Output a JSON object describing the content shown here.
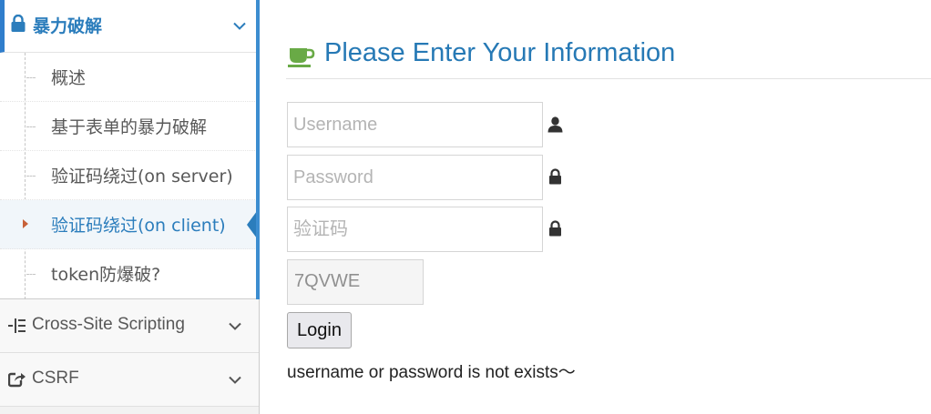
{
  "sidebar": {
    "section": {
      "label": "暴力破解",
      "icon": "lock-icon"
    },
    "items": [
      {
        "label": "概述"
      },
      {
        "label": "基于表单的暴力破解"
      },
      {
        "label": "验证码绕过(on server)"
      },
      {
        "label": "验证码绕过(on client)",
        "active": true
      },
      {
        "label": "token防爆破?"
      }
    ],
    "nav": [
      {
        "label": "Cross-Site Scripting",
        "icon": "list-indent-icon"
      },
      {
        "label": "CSRF",
        "icon": "share-icon"
      }
    ]
  },
  "header": {
    "title": "Please Enter Your Information",
    "icon": "coffee-cup-icon"
  },
  "form": {
    "username_placeholder": "Username",
    "password_placeholder": "Password",
    "captcha_placeholder": "验证码",
    "captcha_code": "7QVWE",
    "login_label": "Login",
    "message": "username or password is not exists～"
  },
  "colors": {
    "accent": "#2b7dbc",
    "title": "#2679b5",
    "cup": "#69aa46",
    "caret": "#c86139"
  }
}
